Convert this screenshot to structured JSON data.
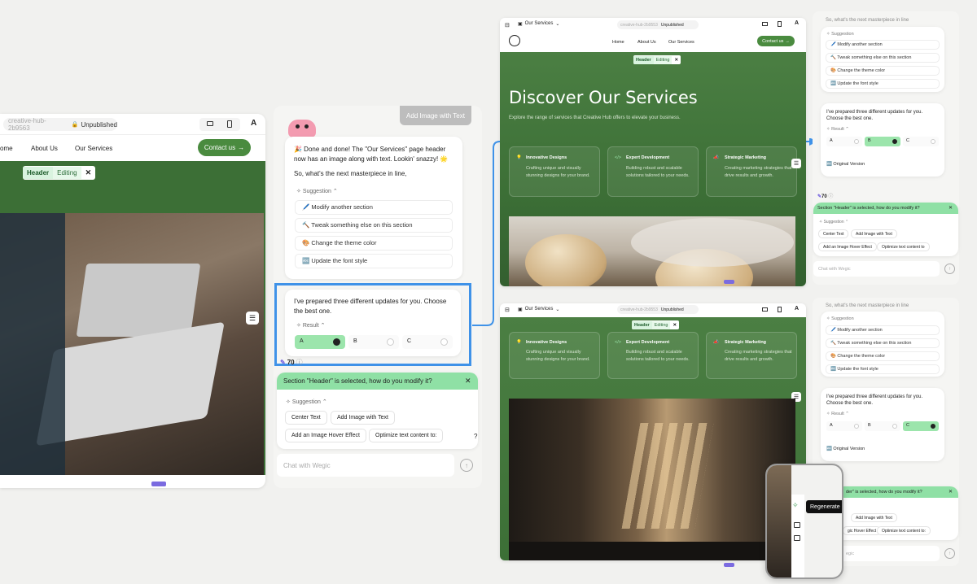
{
  "colors": {
    "accent_green": "#3c6f36",
    "button_green": "#4a8b3f",
    "selection_blue": "#3f92e8",
    "result_green": "#9ce5ac",
    "banner_green": "#8fe0a5"
  },
  "left_editor": {
    "url": "creative-hub-2b9563",
    "status": "Unpublished",
    "nav": [
      "ome",
      "About Us",
      "Our Services"
    ],
    "cta": "Contact us",
    "tag_header": "Header",
    "tag_editing": "Editing"
  },
  "chat": {
    "top_button": "Add Image with Text",
    "message_line1": "🎉 Done and done! The \"Our Services\" page header now has an image along with text. Lookin' snazzy! 🌟",
    "message_line2": "So, what's the next masterpiece in line,",
    "suggestion_label": "Suggestion",
    "suggestions": [
      "🖊️ Modify another section",
      "🔨 Tweak something else on this section",
      "🎨 Change the theme color",
      "🔤 Update the font style"
    ],
    "prepared": "I've prepared three different updates for you. Choose the best one.",
    "result_label": "Result",
    "options": [
      "A",
      "B",
      "C"
    ],
    "credits": "70",
    "banner": "Section \"Header\" is selected, how do you modify it?",
    "quick": [
      "Center Text",
      "Add Image with Text",
      "Add an Image Hover Effect",
      "Optimize text content to:"
    ],
    "input_placeholder": "Chat with Wegic",
    "help": "?"
  },
  "right_top": {
    "page_name": "Our Services",
    "url": "creative-hub-2b9553",
    "status": "Unpublished",
    "nav": [
      "Home",
      "About Us",
      "Our Services"
    ],
    "cta": "Contact us",
    "tag_header": "Header",
    "tag_editing": "Editing",
    "hero_title": "Discover Our Services",
    "hero_sub": "Explore the range of services that Creative Hub offers to elevate your business.",
    "services": [
      {
        "title": "Innovative Designs",
        "desc": "Crafting unique and visually stunning designs for your brand."
      },
      {
        "title": "Expert Development",
        "desc": "Building robust and scalable solutions tailored to your needs."
      },
      {
        "title": "Strategic Marketing",
        "desc": "Creating marketing strategies that drive results and growth."
      }
    ]
  },
  "right_top_chat": {
    "top_text": "So, what's the next masterpiece in line",
    "suggestion_label": "Suggestion",
    "suggestions": [
      "🖊️ Modify another section",
      "🔨 Tweak something else on this section",
      "🎨 Change the theme color",
      "🔤 Update the font style"
    ],
    "prepared": "I've prepared three different updates for you. Choose the best one.",
    "result_label": "Result",
    "options": [
      "A",
      "B",
      "C"
    ],
    "original": "Original Version",
    "credits": "70",
    "banner": "Section \"Header\" is selected, how do you modify it?",
    "quick": [
      "Center Text",
      "Add Image with Text",
      "Add an Image Hover Effect",
      "Optimize text content to"
    ],
    "input_placeholder": "Chat with Wegic"
  },
  "right_bottom": {
    "page_name": "Our Services",
    "url": "creative-hub-2b9553",
    "status": "Unpublished",
    "tag_header": "Header",
    "tag_editing": "Editing",
    "services": [
      {
        "title": "Innovative Designs",
        "desc": "Crafting unique and visually stunning designs for your brand."
      },
      {
        "title": "Expert Development",
        "desc": "Building robust and scalable solutions tailored to your needs."
      },
      {
        "title": "Strategic Marketing",
        "desc": "Creating marketing strategies that drive results and growth."
      }
    ]
  },
  "right_bottom_chat": {
    "top_text": "So, what's the next masterpiece in line",
    "suggestion_label": "Suggestion",
    "suggestions": [
      "🖊️ Modify another section",
      "🔨 Tweak something else on this section",
      "🎨 Change the theme color",
      "🔤 Update the font style"
    ],
    "prepared": "I've prepared three different updates for you. Choose the best one.",
    "result_label": "Result",
    "options": [
      "A",
      "B",
      "C"
    ],
    "original": "Original Version",
    "banner": "der\" is selected, how do you modify it?",
    "quick": [
      "Add Image with Text",
      "gic Hover Effect",
      "Optimize text content to:"
    ],
    "input_placeholder": "egic"
  },
  "zoom_popup": {
    "tooltip": "Regenerate"
  }
}
